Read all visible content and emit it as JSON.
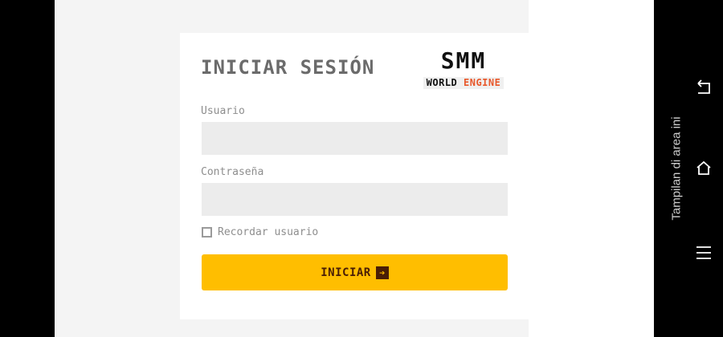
{
  "form": {
    "title": "INICIAR SESIÓN",
    "username_label": "Usuario",
    "username_value": "",
    "password_label": "Contraseña",
    "password_value": "",
    "remember_label": "Recordar usuario",
    "remember_checked": false,
    "submit_label": "INICIAR",
    "submit_icon": "arrow-right-box-icon"
  },
  "logo": {
    "main": "SMM",
    "sub_word1": "WORLD",
    "sub_word2": "ENGINE"
  },
  "navbar": {
    "hint_text": "Tampilan di area ini",
    "icons": [
      "back-icon",
      "home-icon",
      "menu-icon"
    ]
  },
  "colors": {
    "button_bg": "#ffbe00",
    "button_text": "#4a1e06",
    "input_bg": "#ececec",
    "logo_accent": "#e8582b"
  }
}
